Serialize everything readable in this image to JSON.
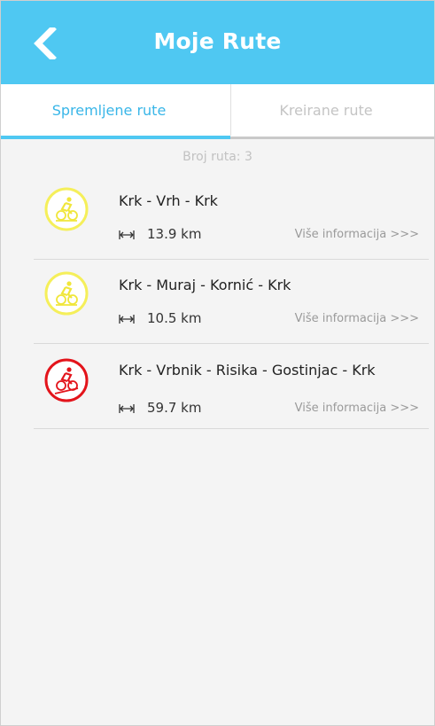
{
  "header": {
    "title": "Moje Rute",
    "back_icon": "chevron-left-icon"
  },
  "tabs": [
    {
      "label": "Spremljene rute",
      "active": true
    },
    {
      "label": "Kreirane rute",
      "active": false
    }
  ],
  "route_count_text": "Broj ruta: 3",
  "routes": [
    {
      "name": "Krk - Vrh - Krk",
      "distance": "13.9 km",
      "more": "Više informacija >>>",
      "difficulty_color": "#f5ef5a",
      "icon": "cyclist-icon"
    },
    {
      "name": "Krk - Muraj - Kornić - Krk",
      "distance": "10.5 km",
      "more": "Više informacija >>>",
      "difficulty_color": "#f5ef5a",
      "icon": "cyclist-icon"
    },
    {
      "name": "Krk - Vrbnik - Risika - Gostinjac - Krk",
      "distance": "59.7 km",
      "more": "Više informacija >>>",
      "difficulty_color": "#e3141b",
      "icon": "cyclist-uphill-icon"
    }
  ],
  "colors": {
    "accent": "#4fc8f2",
    "easy": "#f5ef5a",
    "hard": "#e3141b"
  }
}
